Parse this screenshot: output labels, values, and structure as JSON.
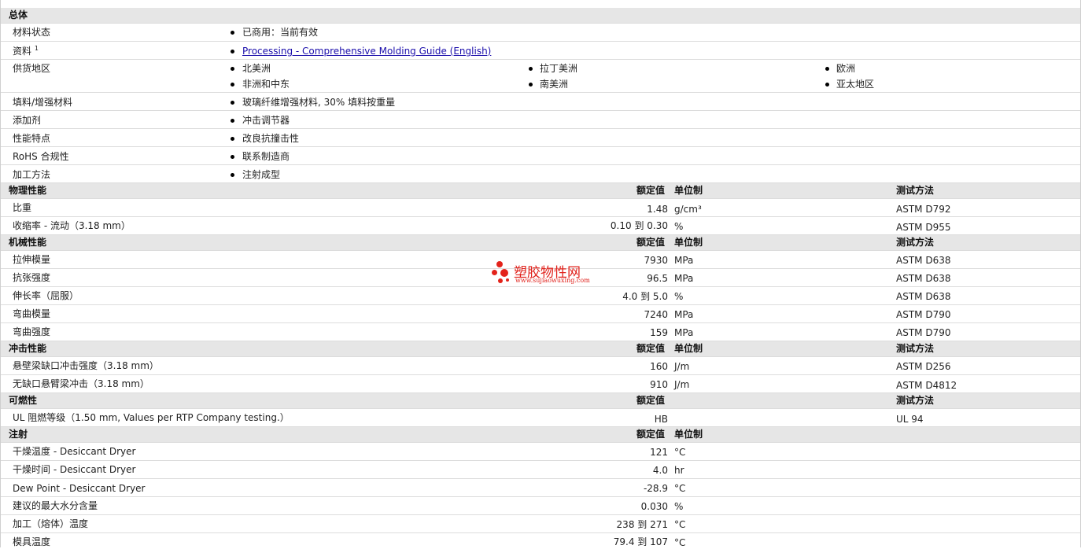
{
  "general": {
    "title": "总体",
    "material_status_label": "材料状态",
    "material_status": "已商用：当前有效",
    "docs_label": "资料",
    "docs_sup": "1",
    "docs_link": "Processing - Comprehensive Molding Guide (English)",
    "supply_label": "供货地区",
    "regions": [
      "北美洲",
      "拉丁美洲",
      "欧洲",
      "非洲和中东",
      "南美洲",
      "亚太地区"
    ],
    "filler_label": "填料/增强材料",
    "filler": "玻璃纤维增强材料, 30% 填料按重量",
    "additive_label": "添加剂",
    "additive": "冲击调节器",
    "features_label": "性能特点",
    "features": "改良抗撞击性",
    "rohs_label": "RoHS 合规性",
    "rohs": "联系制造商",
    "process_label": "加工方法",
    "process": "注射成型"
  },
  "headers": {
    "nominal": "额定值",
    "unit": "单位制",
    "method": "测试方法"
  },
  "physical": {
    "title": "物理性能",
    "rows": [
      {
        "name": "比重",
        "value": "1.48",
        "unit": "g/cm³",
        "method": "ASTM D792"
      },
      {
        "name": "收缩率 - 流动（3.18 mm）",
        "value": "0.10 到  0.30",
        "unit": "%",
        "method": "ASTM D955"
      }
    ]
  },
  "mechanical": {
    "title": "机械性能",
    "rows": [
      {
        "name": "拉伸模量",
        "value": "7930",
        "unit": "MPa",
        "method": "ASTM D638"
      },
      {
        "name": "抗张强度",
        "value": "96.5",
        "unit": "MPa",
        "method": "ASTM D638"
      },
      {
        "name": "伸长率（屈服）",
        "value": "4.0 到  5.0",
        "unit": "%",
        "method": "ASTM D638"
      },
      {
        "name": "弯曲模量",
        "value": "7240",
        "unit": "MPa",
        "method": "ASTM D790"
      },
      {
        "name": "弯曲强度",
        "value": "159",
        "unit": "MPa",
        "method": "ASTM D790"
      }
    ]
  },
  "impact": {
    "title": "冲击性能",
    "rows": [
      {
        "name": "悬壁梁缺口冲击强度（3.18 mm）",
        "value": "160",
        "unit": "J/m",
        "method": "ASTM D256"
      },
      {
        "name": "无缺口悬臂梁冲击（3.18 mm）",
        "value": "910",
        "unit": "J/m",
        "method": "ASTM D4812"
      }
    ]
  },
  "flammability": {
    "title": "可燃性",
    "rows": [
      {
        "name": "UL 阻燃等级（1.50 mm, Values per RTP Company testing.）",
        "value": "HB",
        "unit": "",
        "method": "UL 94"
      }
    ]
  },
  "injection": {
    "title": "注射",
    "rows": [
      {
        "name": "干燥温度 - Desiccant Dryer",
        "value": "121",
        "unit": "°C"
      },
      {
        "name": "干燥时间 - Desiccant Dryer",
        "value": "4.0",
        "unit": "hr"
      },
      {
        "name": "Dew Point - Desiccant Dryer",
        "value": "-28.9",
        "unit": "°C"
      },
      {
        "name": "建议的最大水分含量",
        "value": "0.030",
        "unit": "%"
      },
      {
        "name": "加工（熔体）温度",
        "value": "238 到  271",
        "unit": "°C"
      },
      {
        "name": "模具温度",
        "value": "79.4 到  107",
        "unit": "°C"
      }
    ]
  },
  "watermark": {
    "brand": "塑胶物性网",
    "url": "www.sujiaowuxing.com"
  }
}
